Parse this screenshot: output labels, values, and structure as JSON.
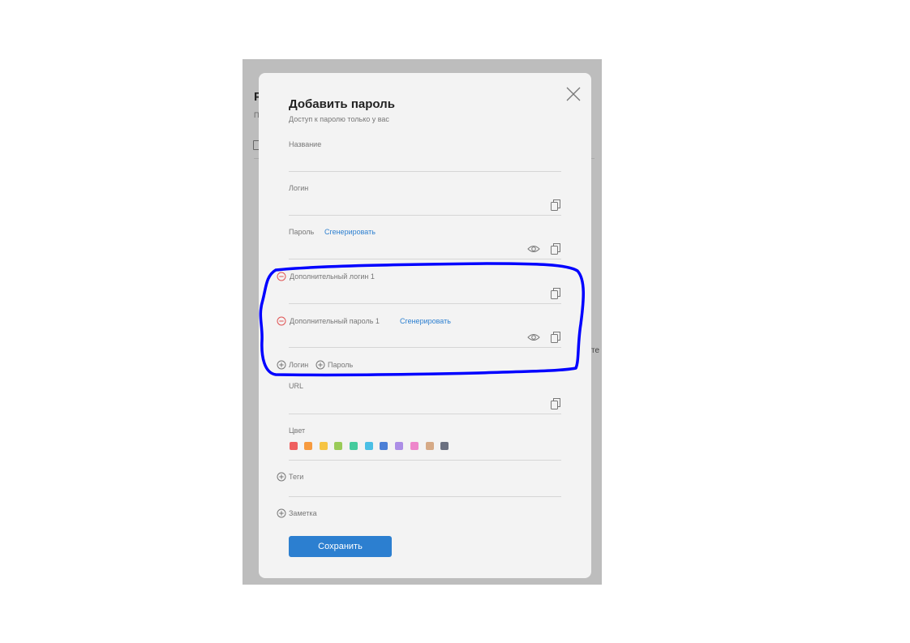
{
  "background": {
    "heading_fragment": "Р",
    "sub_fragment": "П",
    "text_fragment": "те"
  },
  "dialog": {
    "title": "Добавить пароль",
    "subtitle": "Доступ к паролю только у вас"
  },
  "fields": {
    "name_label": "Название",
    "login_label": "Логин",
    "password_label": "Пароль",
    "generate_label": "Сгенерировать",
    "extra_login_label": "Дополнительный логин 1",
    "extra_password_label": "Дополнительный пароль 1",
    "extra_generate_label": "Сгенерировать",
    "add_login_label": "Логин",
    "add_password_label": "Пароль",
    "url_label": "URL",
    "color_label": "Цвет",
    "tags_label": "Теги",
    "note_label": "Заметка"
  },
  "colors": [
    "#ef5f5f",
    "#f79a3e",
    "#f6c443",
    "#9acb58",
    "#45cb9d",
    "#4bbfe5",
    "#4b7fd6",
    "#ac8ee6",
    "#ee86cb",
    "#d6aa86",
    "#6b7080"
  ],
  "accent": "#2c7fd0",
  "annotation_color": "#0000ff",
  "save_label": "Сохранить",
  "icons": {
    "copy": "copy-icon",
    "eye": "eye-icon",
    "close": "close-icon",
    "remove": "minus-circle-icon",
    "add": "plus-circle-icon"
  }
}
